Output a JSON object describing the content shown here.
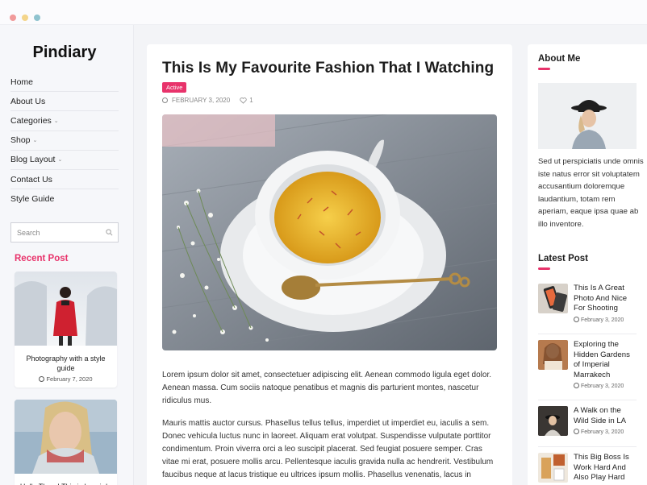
{
  "window": {
    "buttons": [
      "close",
      "minimize",
      "maximize"
    ]
  },
  "site": {
    "logo": "Pindiary"
  },
  "nav": {
    "items": [
      {
        "label": "Home",
        "has_caret": false
      },
      {
        "label": "About Us",
        "has_caret": false
      },
      {
        "label": "Categories",
        "has_caret": true
      },
      {
        "label": "Shop",
        "has_caret": true
      },
      {
        "label": "Blog Layout",
        "has_caret": true
      },
      {
        "label": "Contact Us",
        "has_caret": false
      },
      {
        "label": "Style Guide",
        "has_caret": false
      }
    ],
    "caret": "⌄"
  },
  "search": {
    "placeholder": "Search",
    "icon": "search-icon"
  },
  "recent": {
    "heading": "Recent Post",
    "posts": [
      {
        "title": "Photography with a style guide",
        "date": "February 7, 2020"
      },
      {
        "title": "Hello There! This is how i do Makeup",
        "date": ""
      }
    ]
  },
  "article": {
    "title": "This Is My Favourite Fashion That I Watching",
    "badge": "Active",
    "date": "FEBRUARY 3, 2020",
    "likes": "1",
    "paragraphs": [
      "Lorem ipsum dolor sit amet, consectetuer adipiscing elit. Aenean commodo ligula eget dolor. Aenean massa. Cum sociis natoque penatibus et magnis dis parturient montes, nascetur ridiculus mus.",
      "Mauris mattis auctor cursus. Phasellus tellus tellus, imperdiet ut imperdiet eu, iaculis a sem. Donec vehicula luctus nunc in laoreet. Aliquam erat volutpat. Suspendisse vulputate porttitor condimentum. Proin viverra orci a leo suscipit placerat. Sed feugiat posuere semper. Cras vitae mi erat, posuere mollis arcu. Pellentesque iaculis gravida nulla ac hendrerit. Vestibulum faucibus neque at lacus tristique eu ultrices ipsum mollis. Phasellus venenatis, lacus in"
    ]
  },
  "about": {
    "heading": "About Me",
    "text": "Sed ut perspiciatis unde omnis iste natus error sit voluptatem accusantium doloremque laudantium, totam rem aperiam, eaque ipsa quae ab illo inventore."
  },
  "latest": {
    "heading": "Latest Post",
    "posts": [
      {
        "title": "This Is A Great Photo And Nice For Shooting",
        "date": "February 3, 2020"
      },
      {
        "title": "Exploring the Hidden Gardens of Imperial Marrakech",
        "date": "February 3, 2020"
      },
      {
        "title": "A Walk on the Wild Side in LA",
        "date": "February 3, 2020"
      },
      {
        "title": "This Big Boss Is Work Hard And Also Play Hard",
        "date": ""
      }
    ]
  },
  "colors": {
    "accent": "#e8336b",
    "background": "#f3f4f7"
  }
}
